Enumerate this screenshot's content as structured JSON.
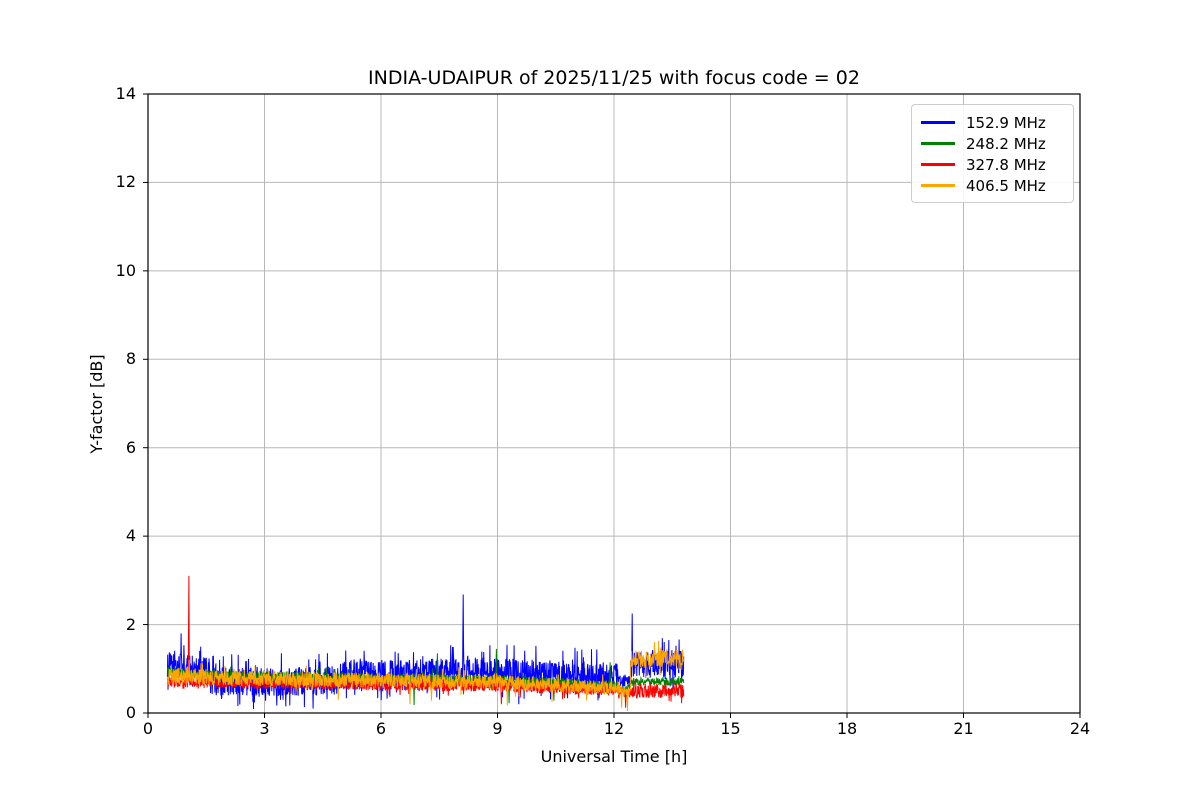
{
  "chart_data": {
    "type": "line",
    "title": "INDIA-UDAIPUR of 2025/11/25 with focus code = 02",
    "xlabel": "Universal Time [h]",
    "ylabel": "Y-factor [dB]",
    "xlim": [
      0,
      24
    ],
    "ylim": [
      0,
      14
    ],
    "xticks": [
      0,
      3,
      6,
      9,
      12,
      15,
      18,
      21,
      24
    ],
    "yticks": [
      0,
      2,
      4,
      6,
      8,
      10,
      12,
      14
    ],
    "grid": true,
    "grid_color": "#b8b8b8",
    "legend_position": "upper right",
    "data_time_range_hours": [
      0.5,
      13.8
    ],
    "series": [
      {
        "name": "152.9 MHz",
        "color": "#0000ff",
        "peak_prob": 0.13,
        "segments": [
          {
            "t0": 0.5,
            "t1": 1.6,
            "v0": 1.08,
            "v1": 0.95,
            "amp": 0.3
          },
          {
            "t0": 1.6,
            "t1": 4.8,
            "v0": 0.72,
            "v1": 0.72,
            "amp": 0.33
          },
          {
            "t0": 4.8,
            "t1": 7.6,
            "v0": 0.85,
            "v1": 0.92,
            "amp": 0.32
          },
          {
            "t0": 7.6,
            "t1": 12.1,
            "v0": 0.95,
            "v1": 0.82,
            "amp": 0.33
          },
          {
            "t0": 12.1,
            "t1": 12.42,
            "v0": 0.72,
            "v1": 0.72,
            "amp": 0.13
          },
          {
            "t0": 12.42,
            "t1": 13.8,
            "v0": 1.08,
            "v1": 1.12,
            "amp": 0.3
          }
        ],
        "spikes": [
          {
            "t": 0.85,
            "v": 1.8
          },
          {
            "t": 3.55,
            "v": 0.15
          },
          {
            "t": 4.25,
            "v": 0.1
          },
          {
            "t": 8.12,
            "v": 2.68
          },
          {
            "t": 9.55,
            "v": 0.2
          },
          {
            "t": 12.47,
            "v": 2.25
          }
        ]
      },
      {
        "name": "248.2 MHz",
        "color": "#008000",
        "peak_prob": 0.05,
        "segments": [
          {
            "t0": 0.5,
            "t1": 1.5,
            "v0": 0.92,
            "v1": 0.88,
            "amp": 0.12
          },
          {
            "t0": 1.5,
            "t1": 9.0,
            "v0": 0.85,
            "v1": 0.74,
            "amp": 0.12
          },
          {
            "t0": 9.0,
            "t1": 12.1,
            "v0": 0.74,
            "v1": 0.6,
            "amp": 0.12
          },
          {
            "t0": 12.1,
            "t1": 12.42,
            "v0": 0.55,
            "v1": 0.55,
            "amp": 0.1
          },
          {
            "t0": 12.42,
            "t1": 13.8,
            "v0": 0.7,
            "v1": 0.72,
            "amp": 0.09
          }
        ],
        "spikes": [
          {
            "t": 6.85,
            "v": 0.18
          },
          {
            "t": 7.45,
            "v": 1.35
          },
          {
            "t": 8.97,
            "v": 1.45
          },
          {
            "t": 9.3,
            "v": 0.22
          },
          {
            "t": 10.45,
            "v": 0.28
          },
          {
            "t": 11.9,
            "v": 1.15
          }
        ]
      },
      {
        "name": "327.8 MHz",
        "color": "#ff0000",
        "peak_prob": 0.05,
        "segments": [
          {
            "t0": 0.5,
            "t1": 1.5,
            "v0": 0.7,
            "v1": 0.68,
            "amp": 0.12
          },
          {
            "t0": 1.5,
            "t1": 9.0,
            "v0": 0.68,
            "v1": 0.6,
            "amp": 0.12
          },
          {
            "t0": 9.0,
            "t1": 12.1,
            "v0": 0.6,
            "v1": 0.5,
            "amp": 0.12
          },
          {
            "t0": 12.1,
            "t1": 12.42,
            "v0": 0.45,
            "v1": 0.45,
            "amp": 0.1
          },
          {
            "t0": 12.42,
            "t1": 13.8,
            "v0": 0.5,
            "v1": 0.5,
            "amp": 0.16
          }
        ],
        "spikes": [
          {
            "t": 1.05,
            "v": 3.1
          },
          {
            "t": 9.1,
            "v": 0.2
          },
          {
            "t": 12.3,
            "v": 0.12
          }
        ]
      },
      {
        "name": "406.5 MHz",
        "color": "#ffa500",
        "peak_prob": 0.06,
        "segments": [
          {
            "t0": 0.5,
            "t1": 1.5,
            "v0": 0.84,
            "v1": 0.82,
            "amp": 0.19
          },
          {
            "t0": 1.5,
            "t1": 9.0,
            "v0": 0.8,
            "v1": 0.7,
            "amp": 0.17
          },
          {
            "t0": 9.0,
            "t1": 12.1,
            "v0": 0.7,
            "v1": 0.56,
            "amp": 0.16
          },
          {
            "t0": 12.1,
            "t1": 12.42,
            "v0": 0.5,
            "v1": 0.5,
            "amp": 0.12
          },
          {
            "t0": 12.42,
            "t1": 13.8,
            "v0": 1.22,
            "v1": 1.25,
            "amp": 0.21
          }
        ],
        "spikes": [
          {
            "t": 4.9,
            "v": 0.3
          },
          {
            "t": 6.75,
            "v": 0.2
          },
          {
            "t": 7.3,
            "v": 0.28
          },
          {
            "t": 9.25,
            "v": 0.17
          },
          {
            "t": 10.4,
            "v": 0.25
          },
          {
            "t": 12.2,
            "v": 0.12
          },
          {
            "t": 12.35,
            "v": 0.05
          }
        ]
      }
    ]
  }
}
